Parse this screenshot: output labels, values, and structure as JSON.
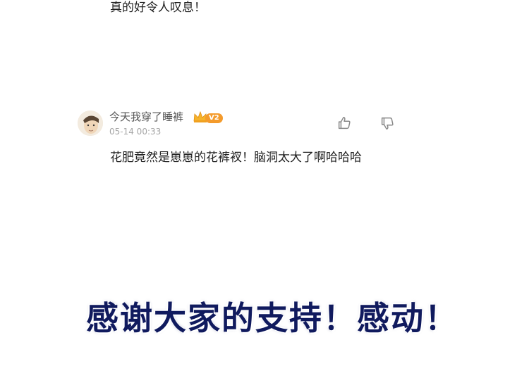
{
  "previous_comment": {
    "text": "真的好令人叹息！"
  },
  "comment": {
    "username": "今天我穿了睡裤",
    "level_badge": "V2",
    "timestamp": "05-14 00:33",
    "body": "花肥竟然是崽崽的花裤衩！脑洞太大了啊哈哈哈",
    "icons": {
      "avatar": "user-avatar",
      "crown": "crown-icon",
      "like": "thumbs-up-icon",
      "dislike": "thumbs-down-icon"
    },
    "colors": {
      "badge": "#f49b2c",
      "crown": "#f6b32a"
    }
  },
  "banner": {
    "text": "感谢大家的支持！感动！",
    "color": "#101a5e"
  }
}
